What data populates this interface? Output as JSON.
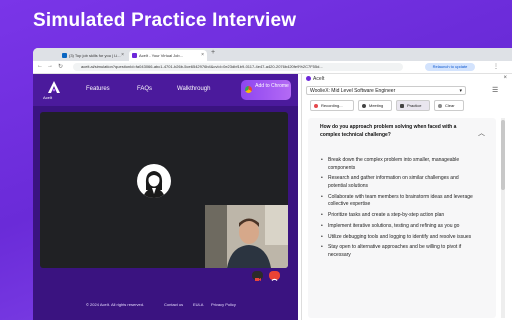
{
  "headline": "Simulated Practice Interview",
  "browser": {
    "tabs": [
      {
        "label": "(3) Top job skills for you | Li..."
      },
      {
        "label": "AceIt - Your Virtual Job..."
      }
    ],
    "url": "aceit.ai/simulation?questionId=fa043066-abc1-4701-b26b-5ce6542976b4&cvId=0e23dbf1b9-0117-4e47-a420-2076b420fe9%2C7F55d...",
    "relaunch": "Relaunch to update"
  },
  "site": {
    "logo_text": "AceIt",
    "nav": [
      "Features",
      "FAQs",
      "Walkthrough"
    ],
    "add_to_chrome": "Add to Chrome",
    "footer": {
      "copyright": "© 2024 AceIt. All rights reserved.",
      "contact": "Contact us",
      "eula": "EULA",
      "privacy": "Privacy Policy"
    }
  },
  "panel": {
    "title": "AceIt",
    "role_select": "WoolieX: Mid Level Software Engineer",
    "buttons": {
      "recording": "Recording...",
      "meeting": "Meeting",
      "practice": "Practice",
      "clear": "Clear"
    },
    "question": "How do you approach problem solving when faced with a complex technical challenge?",
    "answers": [
      "Break down the complex problem into smaller, manageable components",
      "Research and gather information on similar challenges and potential solutions",
      "Collaborate with team members to brainstorm ideas and leverage collective expertise",
      "Prioritize tasks and create a step-by-step action plan",
      "Implement iterative solutions, testing and refining as you go",
      "Utilize debugging tools and logging to identify and resolve issues",
      "Stay open to alternative approaches and be willing to pivot if necessary"
    ]
  },
  "colors": {
    "background": "#6f2ee0",
    "site_bg": "#3a1380",
    "accent": "#6d28d9",
    "mic_button": "#2b2b2b",
    "hangup_button": "#ea4335"
  }
}
